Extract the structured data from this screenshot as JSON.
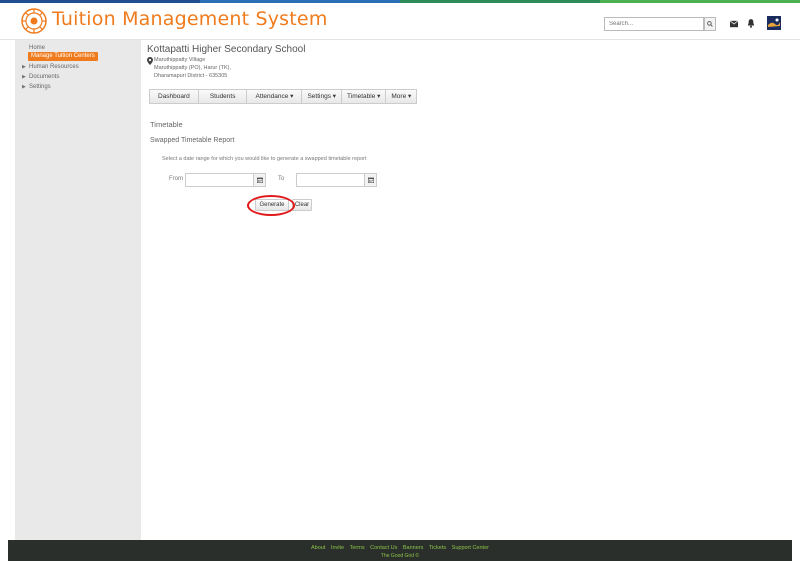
{
  "header": {
    "title": "Tuition Management System",
    "search_placeholder": "Search...",
    "colors": {
      "brand": "#f07b1d"
    }
  },
  "sidebar": {
    "home": "Home",
    "active": "Manage Tuition Centers",
    "items": [
      "Human Resources",
      "Documents",
      "Settings"
    ]
  },
  "school": {
    "name": "Kottapatti Higher Secondary School",
    "address": [
      "Maruthippatty Village",
      "Maruthippatty (PO), Harur (TK),",
      "Dharamapuri District - 635305"
    ]
  },
  "nav": {
    "tabs": [
      "Dashboard",
      "Students",
      "Attendance ▾",
      "Settings ▾",
      "Timetable ▾",
      "More ▾"
    ]
  },
  "page": {
    "title": "Timetable",
    "subtitle": "Swapped Timetable Report",
    "instruction": "Select a date range for which you would like to generate a swapped timetable report",
    "from_label": "From",
    "to_label": "To",
    "generate_label": "Generate",
    "clear_label": "Clear"
  },
  "footer": {
    "links": [
      "About",
      "Invite",
      "Terms",
      "Contact Us",
      "Banners",
      "Tickets",
      "Support Center"
    ],
    "copyright": "The Good Grid ©"
  }
}
